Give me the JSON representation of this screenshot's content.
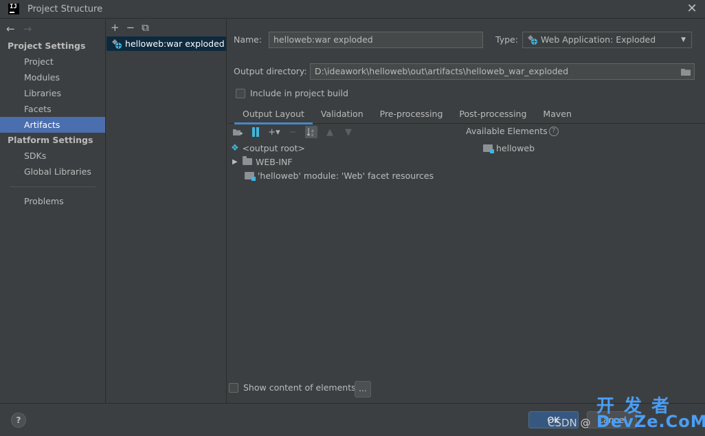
{
  "window": {
    "title": "Project Structure",
    "logo_text": "IJ",
    "close_glyph": "✕"
  },
  "nav": {
    "back_glyph": "←",
    "forward_glyph": "→"
  },
  "sidebar": {
    "project_settings_header": "Project Settings",
    "project_items": [
      {
        "label": "Project"
      },
      {
        "label": "Modules"
      },
      {
        "label": "Libraries"
      },
      {
        "label": "Facets"
      },
      {
        "label": "Artifacts",
        "selected": true
      }
    ],
    "platform_settings_header": "Platform Settings",
    "platform_items": [
      {
        "label": "SDKs"
      },
      {
        "label": "Global Libraries"
      }
    ],
    "problems_label": "Problems"
  },
  "artifacts": {
    "toolbar": {
      "add": "+",
      "remove": "−",
      "copy": "⧉"
    },
    "items": [
      {
        "label": "helloweb:war exploded",
        "icon": "web-artifact-icon"
      }
    ]
  },
  "form": {
    "name_label": "Name:",
    "name_value": "helloweb:war exploded",
    "type_label": "Type:",
    "type_value": "Web Application: Exploded",
    "output_dir_label": "Output directory:",
    "output_dir_value": "D:\\ideawork\\helloweb\\out\\artifacts\\helloweb_war_exploded",
    "include_build_label": "Include in project build"
  },
  "tabs": [
    {
      "label": "Output Layout",
      "active": true
    },
    {
      "label": "Validation"
    },
    {
      "label": "Pre-processing"
    },
    {
      "label": "Post-processing"
    },
    {
      "label": "Maven"
    }
  ],
  "layout": {
    "available_elements_label": "Available Elements",
    "tree": [
      {
        "label": "<output root>",
        "icon": "output-root-icon"
      },
      {
        "label": "WEB-INF",
        "icon": "folder-icon",
        "expandable": true
      },
      {
        "label": "'helloweb' module: 'Web' facet resources",
        "icon": "module-icon"
      }
    ],
    "available": [
      {
        "label": "helloweb",
        "icon": "module-icon"
      }
    ],
    "show_content_label": "Show content of elements",
    "dots_label": "..."
  },
  "footer": {
    "help_label": "?",
    "ok_label": "OK",
    "cancel_label": "Cancel",
    "watermark_csdn": "CSDN @",
    "watermark_cn": "开发者",
    "watermark_dev": "DevZe.CoM"
  },
  "colors": {
    "background": "#3c3f41",
    "selection": "#4b6eaf",
    "artifact_selection": "#0d293e",
    "tab_underline": "#4a88c7",
    "watermark": "#4a9ef5"
  }
}
